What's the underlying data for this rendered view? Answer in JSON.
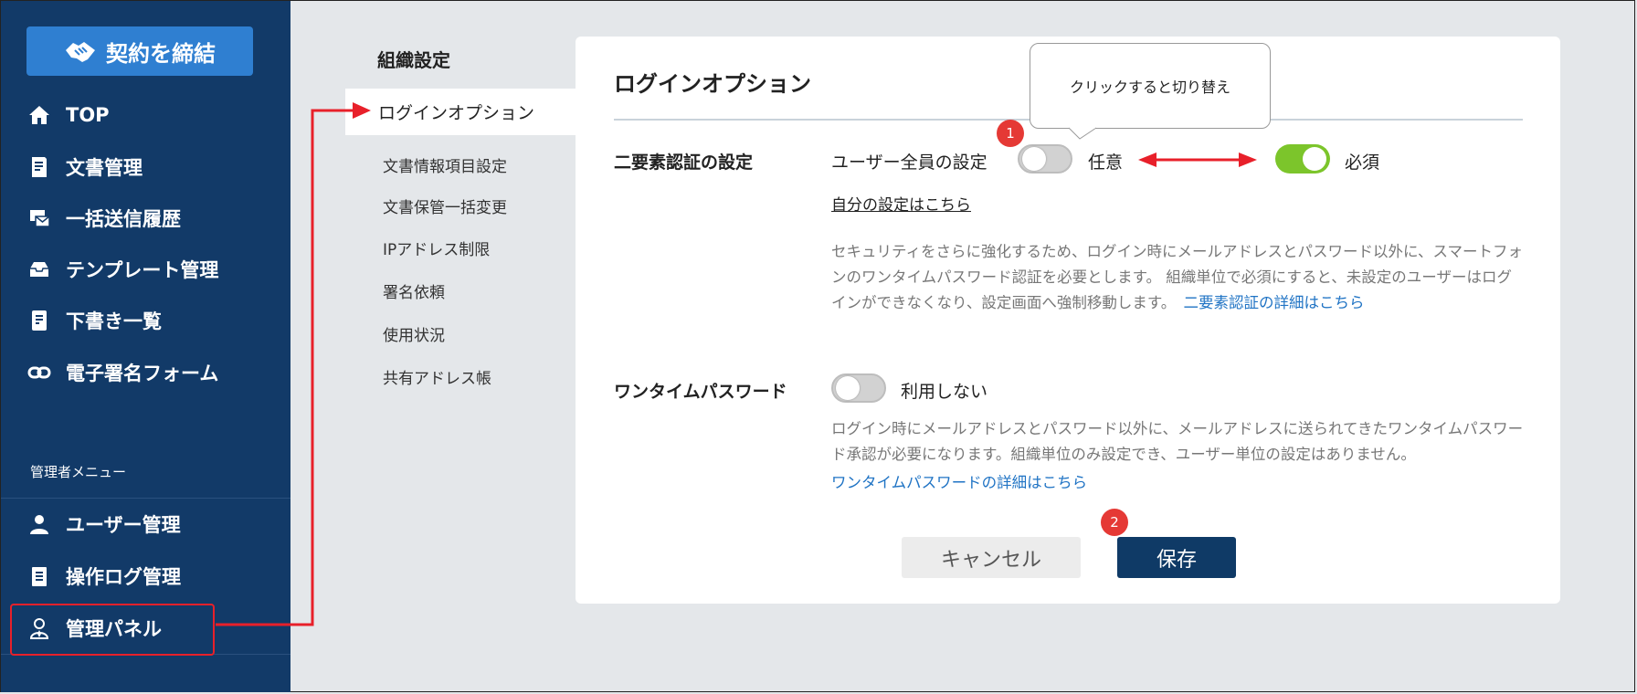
{
  "sidebar": {
    "contract_button": "契約を締結",
    "items": [
      {
        "label": "TOP"
      },
      {
        "label": "文書管理"
      },
      {
        "label": "一括送信履歴"
      },
      {
        "label": "テンプレート管理"
      },
      {
        "label": "下書き一覧"
      },
      {
        "label": "電子署名フォーム"
      }
    ],
    "admin_menu_label": "管理者メニュー",
    "admin_items": [
      {
        "label": "ユーザー管理"
      },
      {
        "label": "操作ログ管理"
      },
      {
        "label": "管理パネル"
      }
    ]
  },
  "submenu": {
    "title": "組織設定",
    "active": "ログインオプション",
    "items": [
      "文書情報項目設定",
      "文書保管一括変更",
      "IPアドレス制限",
      "署名依頼",
      "使用状況",
      "共有アドレス帳"
    ]
  },
  "panel": {
    "title": "ログインオプション",
    "two_factor": {
      "label": "二要素認証の設定",
      "all_users_label": "ユーザー全員の設定",
      "optional_label": "任意",
      "required_label": "必須",
      "own_settings_link": "自分の設定はこちら",
      "description": "セキュリティをさらに強化するため、ログイン時にメールアドレスとパスワード以外に、スマートフォンのワンタイムパスワード認証を必要とします。 組織単位で必須にすると、未設定のユーザーはログインができなくなり、設定画面へ強制移動します。",
      "details_link": "二要素認証の詳細はこちら"
    },
    "one_time": {
      "label": "ワンタイムパスワード",
      "state_label": "利用しない",
      "description": "ログイン時にメールアドレスとパスワード以外に、メールアドレスに送られてきたワンタイムパスワード承認が必要になります。組織単位のみ設定でき、ユーザー単位の設定はありません。",
      "details_link": "ワンタイムパスワードの詳細はこちら"
    },
    "cancel_label": "キャンセル",
    "save_label": "保存"
  },
  "annotations": {
    "tooltip": "クリックすると切り替え",
    "badge1": "1",
    "badge2": "2"
  },
  "colors": {
    "sidebar": "#123a68",
    "accent": "#2f7fd1",
    "toggle_on": "#7cc52b",
    "save": "#0f3a66",
    "annotation": "#e8202a"
  }
}
